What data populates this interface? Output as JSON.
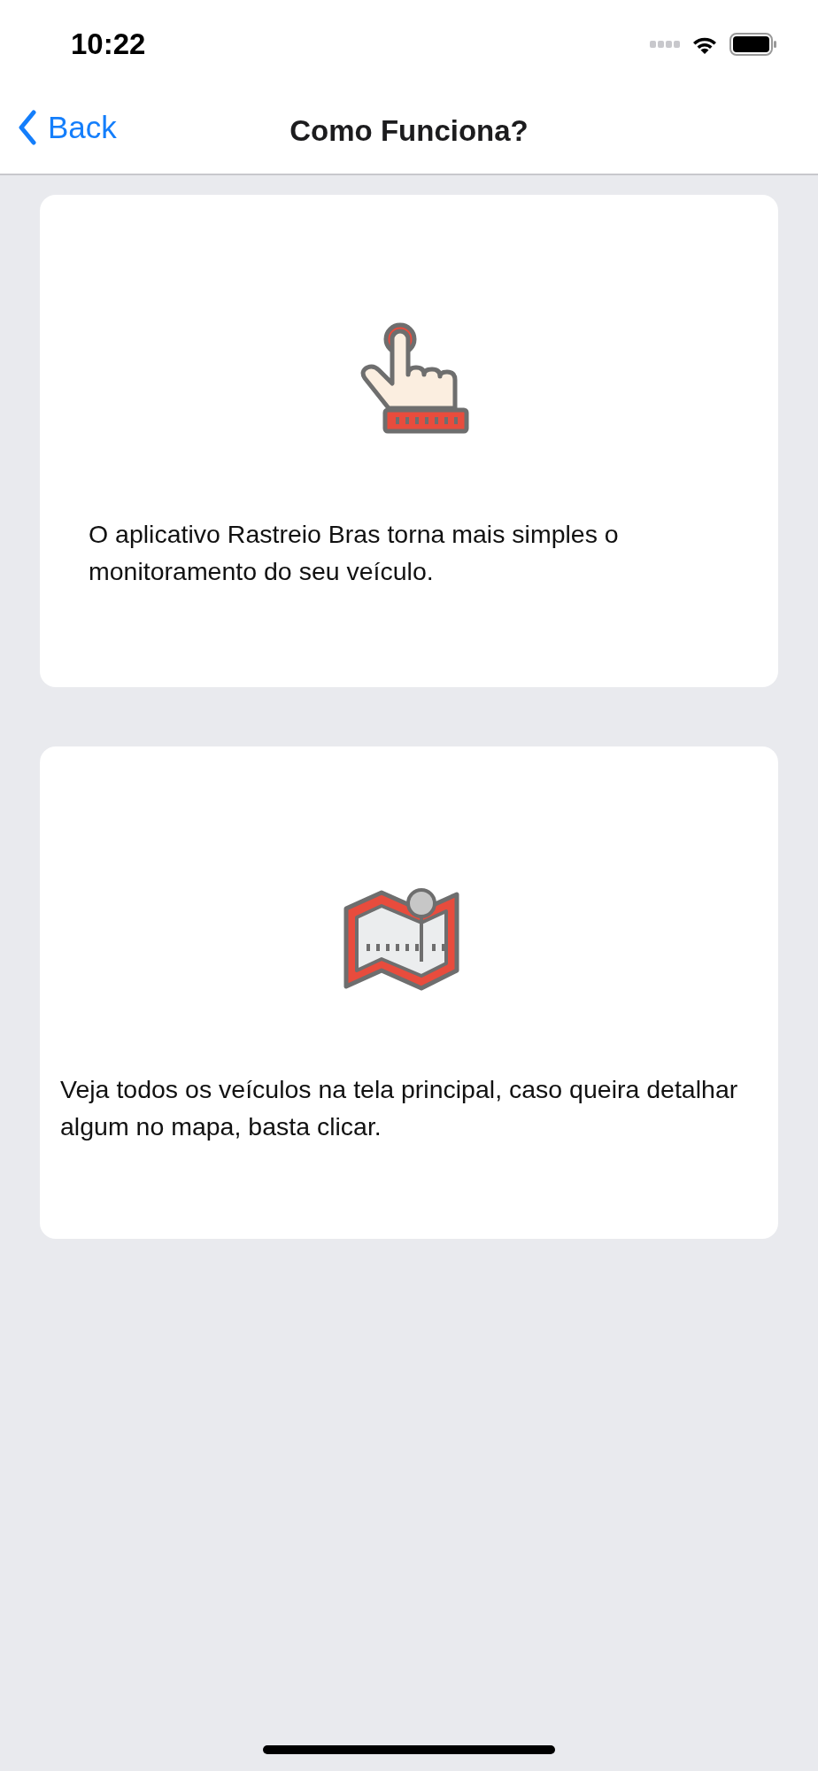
{
  "status_bar": {
    "time": "10:22"
  },
  "nav_bar": {
    "back": "Back",
    "title": "Como Funciona?"
  },
  "cards": [
    {
      "kind": "hand",
      "text": "O aplicativo Rastreio Bras torna mais simples o monitoramento do seu veículo."
    },
    {
      "kind": "map",
      "text": "Veja todos os veículos na tela principal, caso queira detalhar algum no mapa, basta clicar."
    }
  ]
}
